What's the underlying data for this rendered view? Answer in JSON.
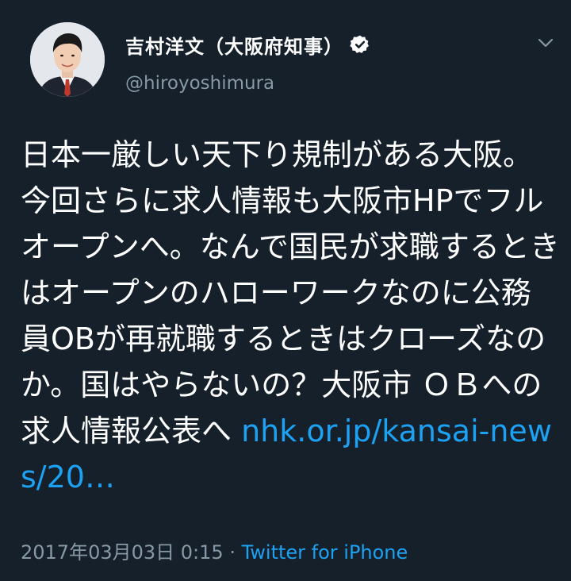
{
  "account": {
    "display_name": "吉村洋文（大阪府知事）",
    "handle": "@hiroyoshimura",
    "verified_icon": "verified-badge-icon",
    "menu_icon": "chevron-down-icon"
  },
  "tweet": {
    "text": "日本一厳しい天下り規制がある大阪。今回さらに求人情報も大阪市HPでフルオープンへ。なんで国民が求職するときはオープンのハローワークなのに公務員OBが再就職するときはクローズなのか。国はやらないの？大阪市 ＯＢへの求人情報公表へ ",
    "link_text": "nhk.or.jp/kansai-news/20…",
    "timestamp": "2017年03月03日 0:15",
    "separator": " · ",
    "source": "Twitter for iPhone"
  },
  "colors": {
    "background": "#15202b",
    "text": "#ffffff",
    "secondary": "#8899a6",
    "link": "#1da1f2"
  }
}
